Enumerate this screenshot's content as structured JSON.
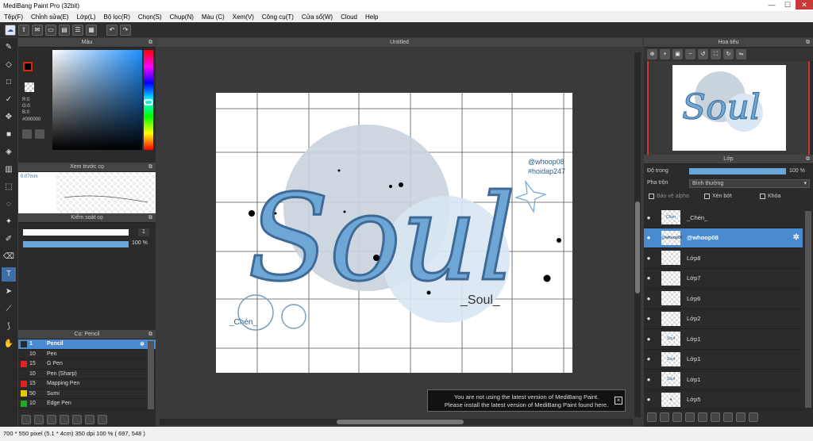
{
  "window": {
    "title": "MediBang Paint Pro (32bit)",
    "minimize": "—",
    "maximize": "☐",
    "close": "✕"
  },
  "menu": [
    "Tệp(F)",
    "Chỉnh sửa(E)",
    "Lớp(L)",
    "Bộ lọc(R)",
    "Chọn(S)",
    "Chụp(N)",
    "Màu (C)",
    "Xem(V)",
    "Công cụ(T)",
    "Cửa sổ(W)",
    "Cloud",
    "Help"
  ],
  "panels": {
    "color": {
      "title": "Màu",
      "r": "R:0",
      "g": "G:0",
      "b": "B:0",
      "hex": "#000000"
    },
    "brush_preview": {
      "title": "Xem trước cọ",
      "size": "0.07mm"
    },
    "brush_control": {
      "title": "Kiểm soát cọ",
      "size_value": "1",
      "opacity_value": "100 %"
    },
    "brushes": {
      "title": "Cọ: Pencil",
      "items": [
        {
          "size": "1",
          "name": "Pencil",
          "color": "#2a2a2a"
        },
        {
          "size": "10",
          "name": "Pen",
          "color": "#2a2a2a"
        },
        {
          "size": "15",
          "name": "G Pen",
          "color": "#d22"
        },
        {
          "size": "10",
          "name": "Pen (Sharp)",
          "color": "#2a2a2a"
        },
        {
          "size": "15",
          "name": "Mapping Pen",
          "color": "#d22"
        },
        {
          "size": "50",
          "name": "Sumi",
          "color": "#e6c800"
        },
        {
          "size": "10",
          "name": "Edge Pen",
          "color": "#2a2"
        }
      ]
    }
  },
  "canvas": {
    "tab": "Untitled"
  },
  "artwork": {
    "main": "Soul",
    "sub": "_Soul_",
    "handle": "@whoop08",
    "tag": "#hoidap247",
    "sign": "_Chén_"
  },
  "navigator": {
    "title": "Hoa tiêu"
  },
  "layer_panel": {
    "title": "Lớp",
    "opacity_label": "Độ trong",
    "opacity_value": "100 %",
    "blend_label": "Pha trộn",
    "blend_value": "Bình thường",
    "protect_alpha": "Bảo vệ alpha",
    "clipping": "Xén bớt",
    "lock": "Khóa",
    "layers": [
      {
        "name": "_Chén_",
        "thumb": "Chén"
      },
      {
        "name": "@whoop08",
        "thumb": "@whoop08"
      },
      {
        "name": "Lớp8",
        "thumb": ""
      },
      {
        "name": "Lớp7",
        "thumb": ""
      },
      {
        "name": "Lớp6",
        "thumb": ""
      },
      {
        "name": "Lớp2",
        "thumb": ""
      },
      {
        "name": "Lớp1",
        "thumb": "Soul"
      },
      {
        "name": "Lớp1",
        "thumb": "Soul"
      },
      {
        "name": "Lớp1",
        "thumb": "Soul"
      },
      {
        "name": "Lớp5",
        "thumb": "●"
      }
    ]
  },
  "notice": {
    "line1": "You are not using the latest version of MediBang Paint.",
    "line2": "Please install the latest version of MediBang Paint found here."
  },
  "status": "700 * 550 pixel  (5.1 * 4cm)  350 dpi  100 %  ( 697, 548 )"
}
